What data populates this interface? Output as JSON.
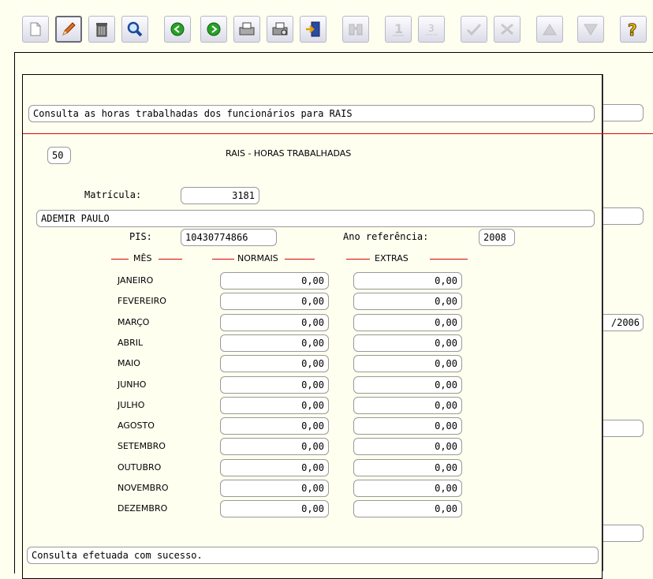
{
  "toolbar": {
    "buttons": [
      {
        "name": "new-document",
        "icon": "new-document-icon",
        "disabled": false
      },
      {
        "name": "edit",
        "icon": "pencil-icon",
        "disabled": false,
        "active": true
      },
      {
        "name": "delete",
        "icon": "trash-icon",
        "disabled": false
      },
      {
        "name": "search",
        "icon": "magnifier-icon",
        "disabled": false
      },
      {
        "name": "previous",
        "icon": "arrow-left-icon",
        "disabled": false
      },
      {
        "name": "next",
        "icon": "arrow-right-icon",
        "disabled": false
      },
      {
        "name": "print",
        "icon": "printer-icon",
        "disabled": false
      },
      {
        "name": "print-preview",
        "icon": "printer-preview-icon",
        "disabled": false
      },
      {
        "name": "exit",
        "icon": "exit-door-icon",
        "disabled": false
      },
      {
        "name": "binoculars",
        "icon": "binoculars-icon",
        "disabled": true
      },
      {
        "name": "number-1",
        "icon": "number-one-icon",
        "disabled": true
      },
      {
        "name": "number-3",
        "icon": "number-three-icon",
        "disabled": true
      },
      {
        "name": "confirm",
        "icon": "checkmark-icon",
        "disabled": true
      },
      {
        "name": "cancel",
        "icon": "cancel-x-icon",
        "disabled": true
      },
      {
        "name": "move-up",
        "icon": "triangle-up-icon",
        "disabled": true
      },
      {
        "name": "move-down",
        "icon": "triangle-down-icon",
        "disabled": true
      },
      {
        "name": "help",
        "icon": "help-question-icon",
        "disabled": false
      }
    ]
  },
  "background": {
    "partial_date": "/2006"
  },
  "dialog": {
    "description": "Consulta as horas trabalhadas dos funcionários para RAIS",
    "screen_code": "50",
    "title": "RAIS - HORAS TRABALHADAS",
    "matricula_label": "Matrícula:",
    "matricula_value": "3181",
    "employee_name": "ADEMIR PAULO",
    "pis_label": "PIS:",
    "pis_value": "10430774866",
    "ano_label": "Ano referência:",
    "ano_value": "2008",
    "headers": {
      "mes": "MÊS",
      "normais": "NORMAIS",
      "extras": "EXTRAS"
    },
    "months": [
      {
        "mes": "JANEIRO",
        "normais": "0,00",
        "extras": "0,00"
      },
      {
        "mes": "FEVEREIRO",
        "normais": "0,00",
        "extras": "0,00"
      },
      {
        "mes": "MARÇO",
        "normais": "0,00",
        "extras": "0,00"
      },
      {
        "mes": "ABRIL",
        "normais": "0,00",
        "extras": "0,00"
      },
      {
        "mes": "MAIO",
        "normais": "0,00",
        "extras": "0,00"
      },
      {
        "mes": "JUNHO",
        "normais": "0,00",
        "extras": "0,00"
      },
      {
        "mes": "JULHO",
        "normais": "0,00",
        "extras": "0,00"
      },
      {
        "mes": "AGOSTO",
        "normais": "0,00",
        "extras": "0,00"
      },
      {
        "mes": "SETEMBRO",
        "normais": "0,00",
        "extras": "0,00"
      },
      {
        "mes": "OUTUBRO",
        "normais": "0,00",
        "extras": "0,00"
      },
      {
        "mes": "NOVEMBRO",
        "normais": "0,00",
        "extras": "0,00"
      },
      {
        "mes": "DEZEMBRO",
        "normais": "0,00",
        "extras": "0,00"
      }
    ],
    "status": "Consulta efetuada com sucesso."
  },
  "colors": {
    "accent_line": "#dd0000",
    "background": "#fffff0"
  }
}
